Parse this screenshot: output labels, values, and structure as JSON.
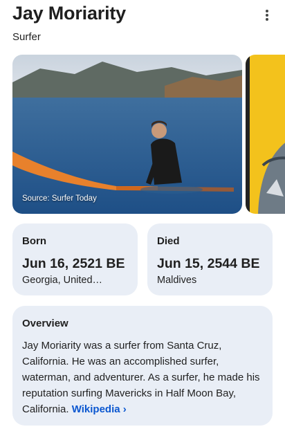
{
  "header": {
    "title": "Jay Moriarity",
    "subtitle": "Surfer"
  },
  "image": {
    "source_label": "Source: Surfer Today"
  },
  "facts": {
    "born": {
      "label": "Born",
      "value": "Jun 16, 2521 BE",
      "place": "Georgia, United…"
    },
    "died": {
      "label": "Died",
      "value": "Jun 15, 2544 BE",
      "place": "Maldives"
    }
  },
  "overview": {
    "label": "Overview",
    "text": "Jay Moriarity was a surfer from Santa Cruz, California. He was an accomplished surfer, waterman, and adventurer. As a surfer, he made his reputation surfing Mavericks in Half Moon Bay, California.",
    "link_label": "Wikipedia",
    "link_chevron": "›"
  },
  "colors": {
    "card_bg": "#e9eef6",
    "link": "#0b57d0"
  }
}
